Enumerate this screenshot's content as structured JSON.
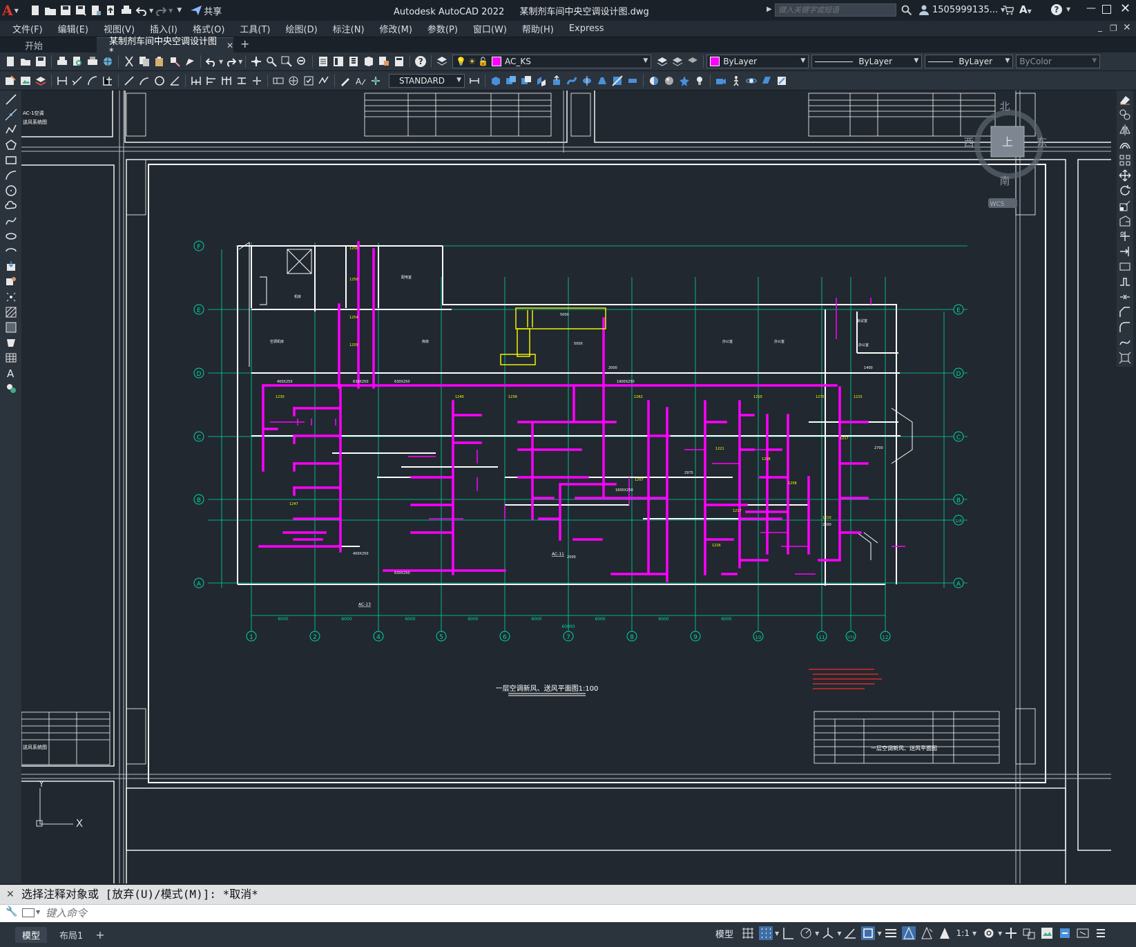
{
  "app": {
    "title": "Autodesk AutoCAD 2022",
    "filename": "某制剂车间中央空调设计图.dwg",
    "share_label": "共享",
    "search_placeholder": "键入关键字或短语",
    "user": "1505999135..."
  },
  "menu": [
    "文件(F)",
    "编辑(E)",
    "视图(V)",
    "插入(I)",
    "格式(O)",
    "工具(T)",
    "绘图(D)",
    "标注(N)",
    "修改(M)",
    "参数(P)",
    "窗口(W)",
    "帮助(H)",
    "Express"
  ],
  "tabs": {
    "start": "开始",
    "active": "某制剂车间中央空调设计图*"
  },
  "toolbar": {
    "layer": "AC_KS",
    "color": "ByLayer",
    "linetype": "ByLayer",
    "lineweight": "ByLayer",
    "plotstyle": "ByColor",
    "textstyle": "STANDARD"
  },
  "drawing": {
    "plan_title": "一层空调新风、送风平面图1:100",
    "left_title_blocks": [
      "AC-1空调",
      "送风系统图",
      "送风系统图"
    ],
    "right_title_text": "一层空调新风、送风平面图",
    "axes_x": [
      "1",
      "2",
      "4",
      "5",
      "6",
      "7",
      "8",
      "9",
      "10",
      "11",
      "1/11",
      "12"
    ],
    "axes_y": [
      "F",
      "E",
      "D",
      "C",
      "B",
      "1/A",
      "A"
    ],
    "labels": [
      "AC-13",
      "AC-11"
    ],
    "total_width_dim": "60000",
    "span_dim": "6000"
  },
  "viewcube": {
    "north": "北",
    "south": "南",
    "east": "东",
    "west": "西",
    "top_face": "上",
    "wcs": "WCS"
  },
  "ucs": {
    "x": "X",
    "y": "Y"
  },
  "command": {
    "history": "选择注释对象或 [放弃(U)/模式(M)]: *取消*",
    "placeholder": "键入命令"
  },
  "status": {
    "tabs": [
      "模型",
      "布局1"
    ],
    "model_label": "模型",
    "scale": "1:1"
  },
  "colors": {
    "background": "#212830",
    "duct": "#ff00ff",
    "grid_axis": "#00d9a3",
    "walls": "#ffffff",
    "annotation": "#ffff00",
    "note_red": "#ff2a2a"
  }
}
